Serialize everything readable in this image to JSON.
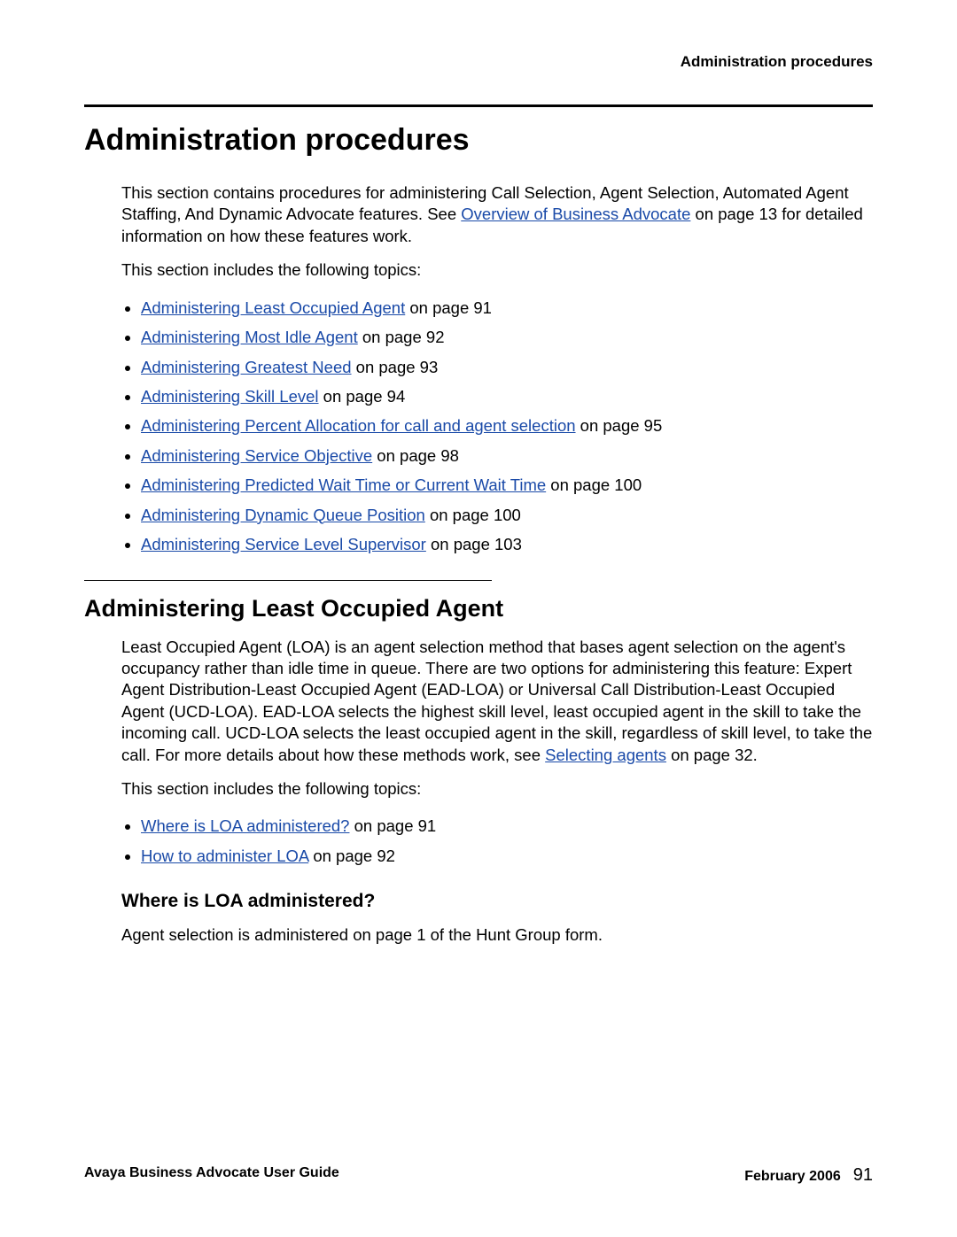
{
  "runningHead": "Administration procedures",
  "title": "Administration procedures",
  "intro": {
    "pre": "This section contains procedures for administering Call Selection, Agent Selection, Automated Agent Staffing, And Dynamic Advocate features. See ",
    "link": "Overview of Business Advocate",
    "post": " on page 13 for detailed information on how these features work."
  },
  "topicsLead": "This section includes the following topics:",
  "topics": [
    {
      "link": "Administering Least Occupied Agent",
      "tail": " on page 91"
    },
    {
      "link": "Administering Most Idle Agent",
      "tail": " on page 92"
    },
    {
      "link": "Administering Greatest Need",
      "tail": " on page 93"
    },
    {
      "link": "Administering Skill Level",
      "tail": " on page 94"
    },
    {
      "link": "Administering Percent Allocation for call and agent selection",
      "tail": " on page 95"
    },
    {
      "link": "Administering Service Objective",
      "tail": " on page 98"
    },
    {
      "link": "Administering Predicted Wait Time or Current Wait Time",
      "tail": " on page 100"
    },
    {
      "link": "Administering Dynamic Queue Position",
      "tail": " on page 100"
    },
    {
      "link": "Administering Service Level Supervisor",
      "tail": " on page 103"
    }
  ],
  "sub": {
    "title": "Administering Least Occupied Agent",
    "para": {
      "pre": "Least Occupied Agent (LOA) is an agent selection method that bases agent selection on the agent's occupancy rather than idle time in queue. There are two options for administering this feature: Expert Agent Distribution-Least Occupied Agent (EAD-LOA) or Universal Call Distribution-Least Occupied Agent (UCD-LOA). EAD-LOA selects the highest skill level, least occupied agent in the skill to take the incoming call. UCD-LOA selects the least occupied agent in the skill, regardless of skill level, to take the call. For more details about how these methods work, see ",
      "link": "Selecting agents",
      "post": " on page 32."
    },
    "topicsLead": "This section includes the following topics:",
    "topics": [
      {
        "link": "Where is LOA administered?",
        "tail": " on page 91"
      },
      {
        "link": "How to administer LOA",
        "tail": " on page 92"
      }
    ],
    "subsub": {
      "title": "Where is LOA administered?",
      "para": "Agent selection is administered on page 1 of the Hunt Group form."
    }
  },
  "footer": {
    "left": "Avaya Business Advocate User Guide",
    "date": "February 2006",
    "page": "91"
  }
}
